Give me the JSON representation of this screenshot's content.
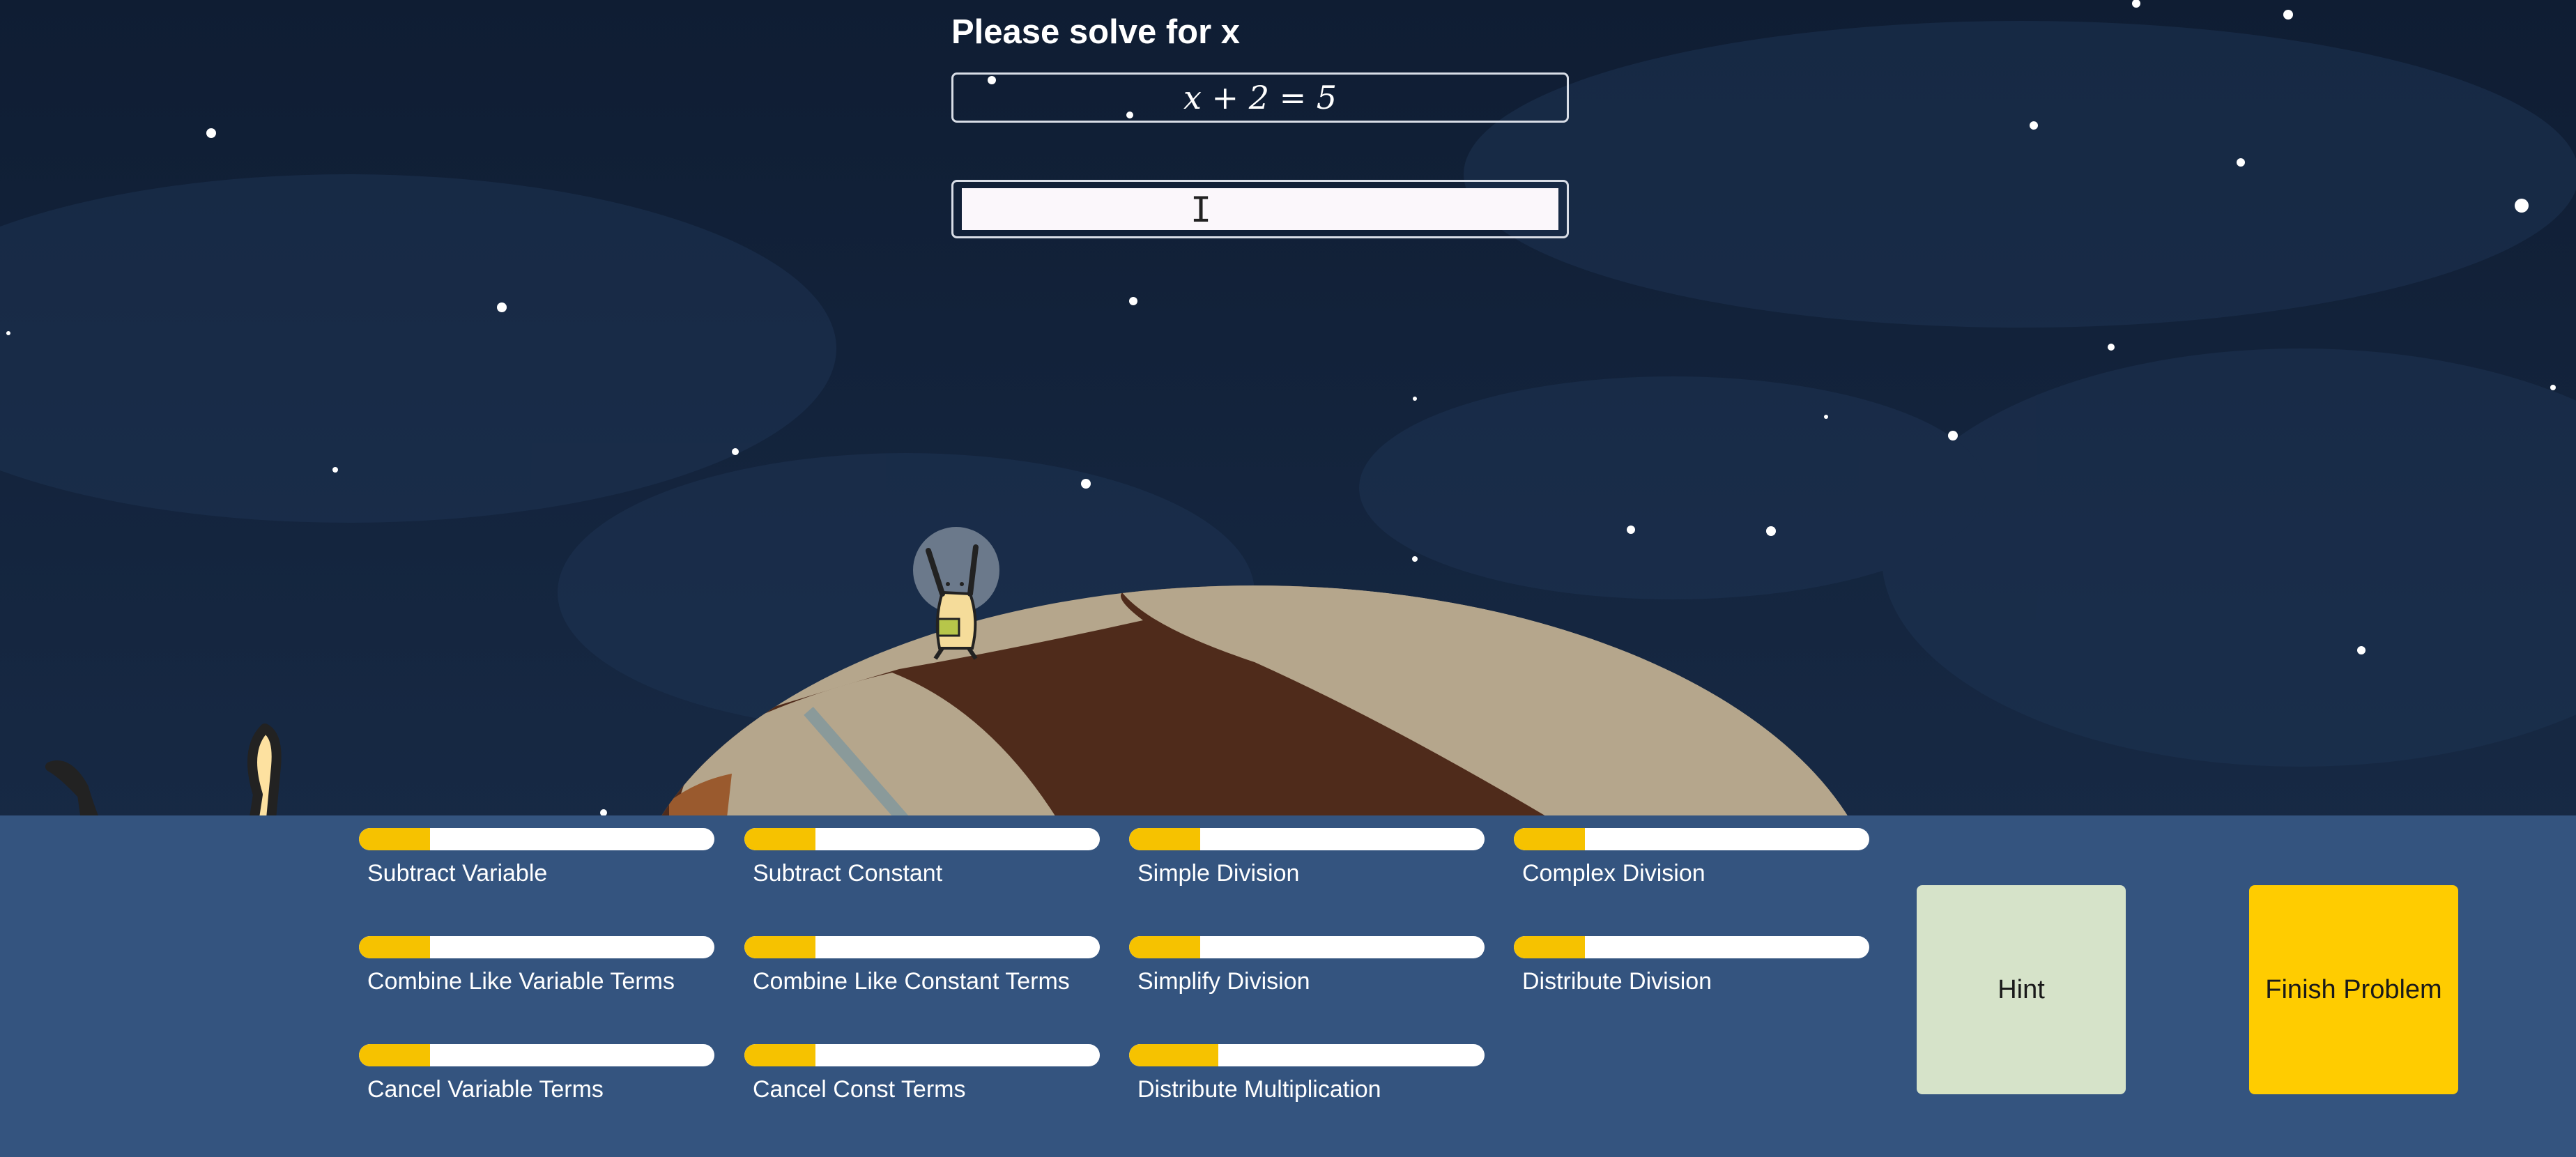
{
  "problem": {
    "prompt": "Please solve for x",
    "equation": "x + 2 = 5",
    "answer_value": "",
    "answer_placeholder": ""
  },
  "skills": [
    {
      "label": "Subtract Variable",
      "progress": 0.2
    },
    {
      "label": "Subtract Constant",
      "progress": 0.2
    },
    {
      "label": "Simple Division",
      "progress": 0.2
    },
    {
      "label": "Complex Division",
      "progress": 0.2
    },
    {
      "label": "Combine Like Variable Terms",
      "progress": 0.2
    },
    {
      "label": "Combine Like Constant Terms",
      "progress": 0.2
    },
    {
      "label": "Simplify Division",
      "progress": 0.2
    },
    {
      "label": "Distribute Division",
      "progress": 0.2
    },
    {
      "label": "Cancel Variable Terms",
      "progress": 0.2
    },
    {
      "label": "Cancel Const Terms",
      "progress": 0.2
    },
    {
      "label": "Distribute Multiplication",
      "progress": 0.25
    }
  ],
  "buttons": {
    "hint_label": "Hint",
    "finish_label": "Finish Problem"
  },
  "colors": {
    "sky": "#12213a",
    "panel": "#34547f",
    "progress_fill": "#f6c200",
    "hint_button": "#d6e3c9",
    "finish_button": "#ffcc00",
    "planet_light": "#b5a68c",
    "planet_dark": "#4f2b1b"
  },
  "icons": {
    "mascot": "waving-alien-icon",
    "astronaut": "alien-astronaut-icon",
    "cursor": "text-cursor-icon"
  }
}
